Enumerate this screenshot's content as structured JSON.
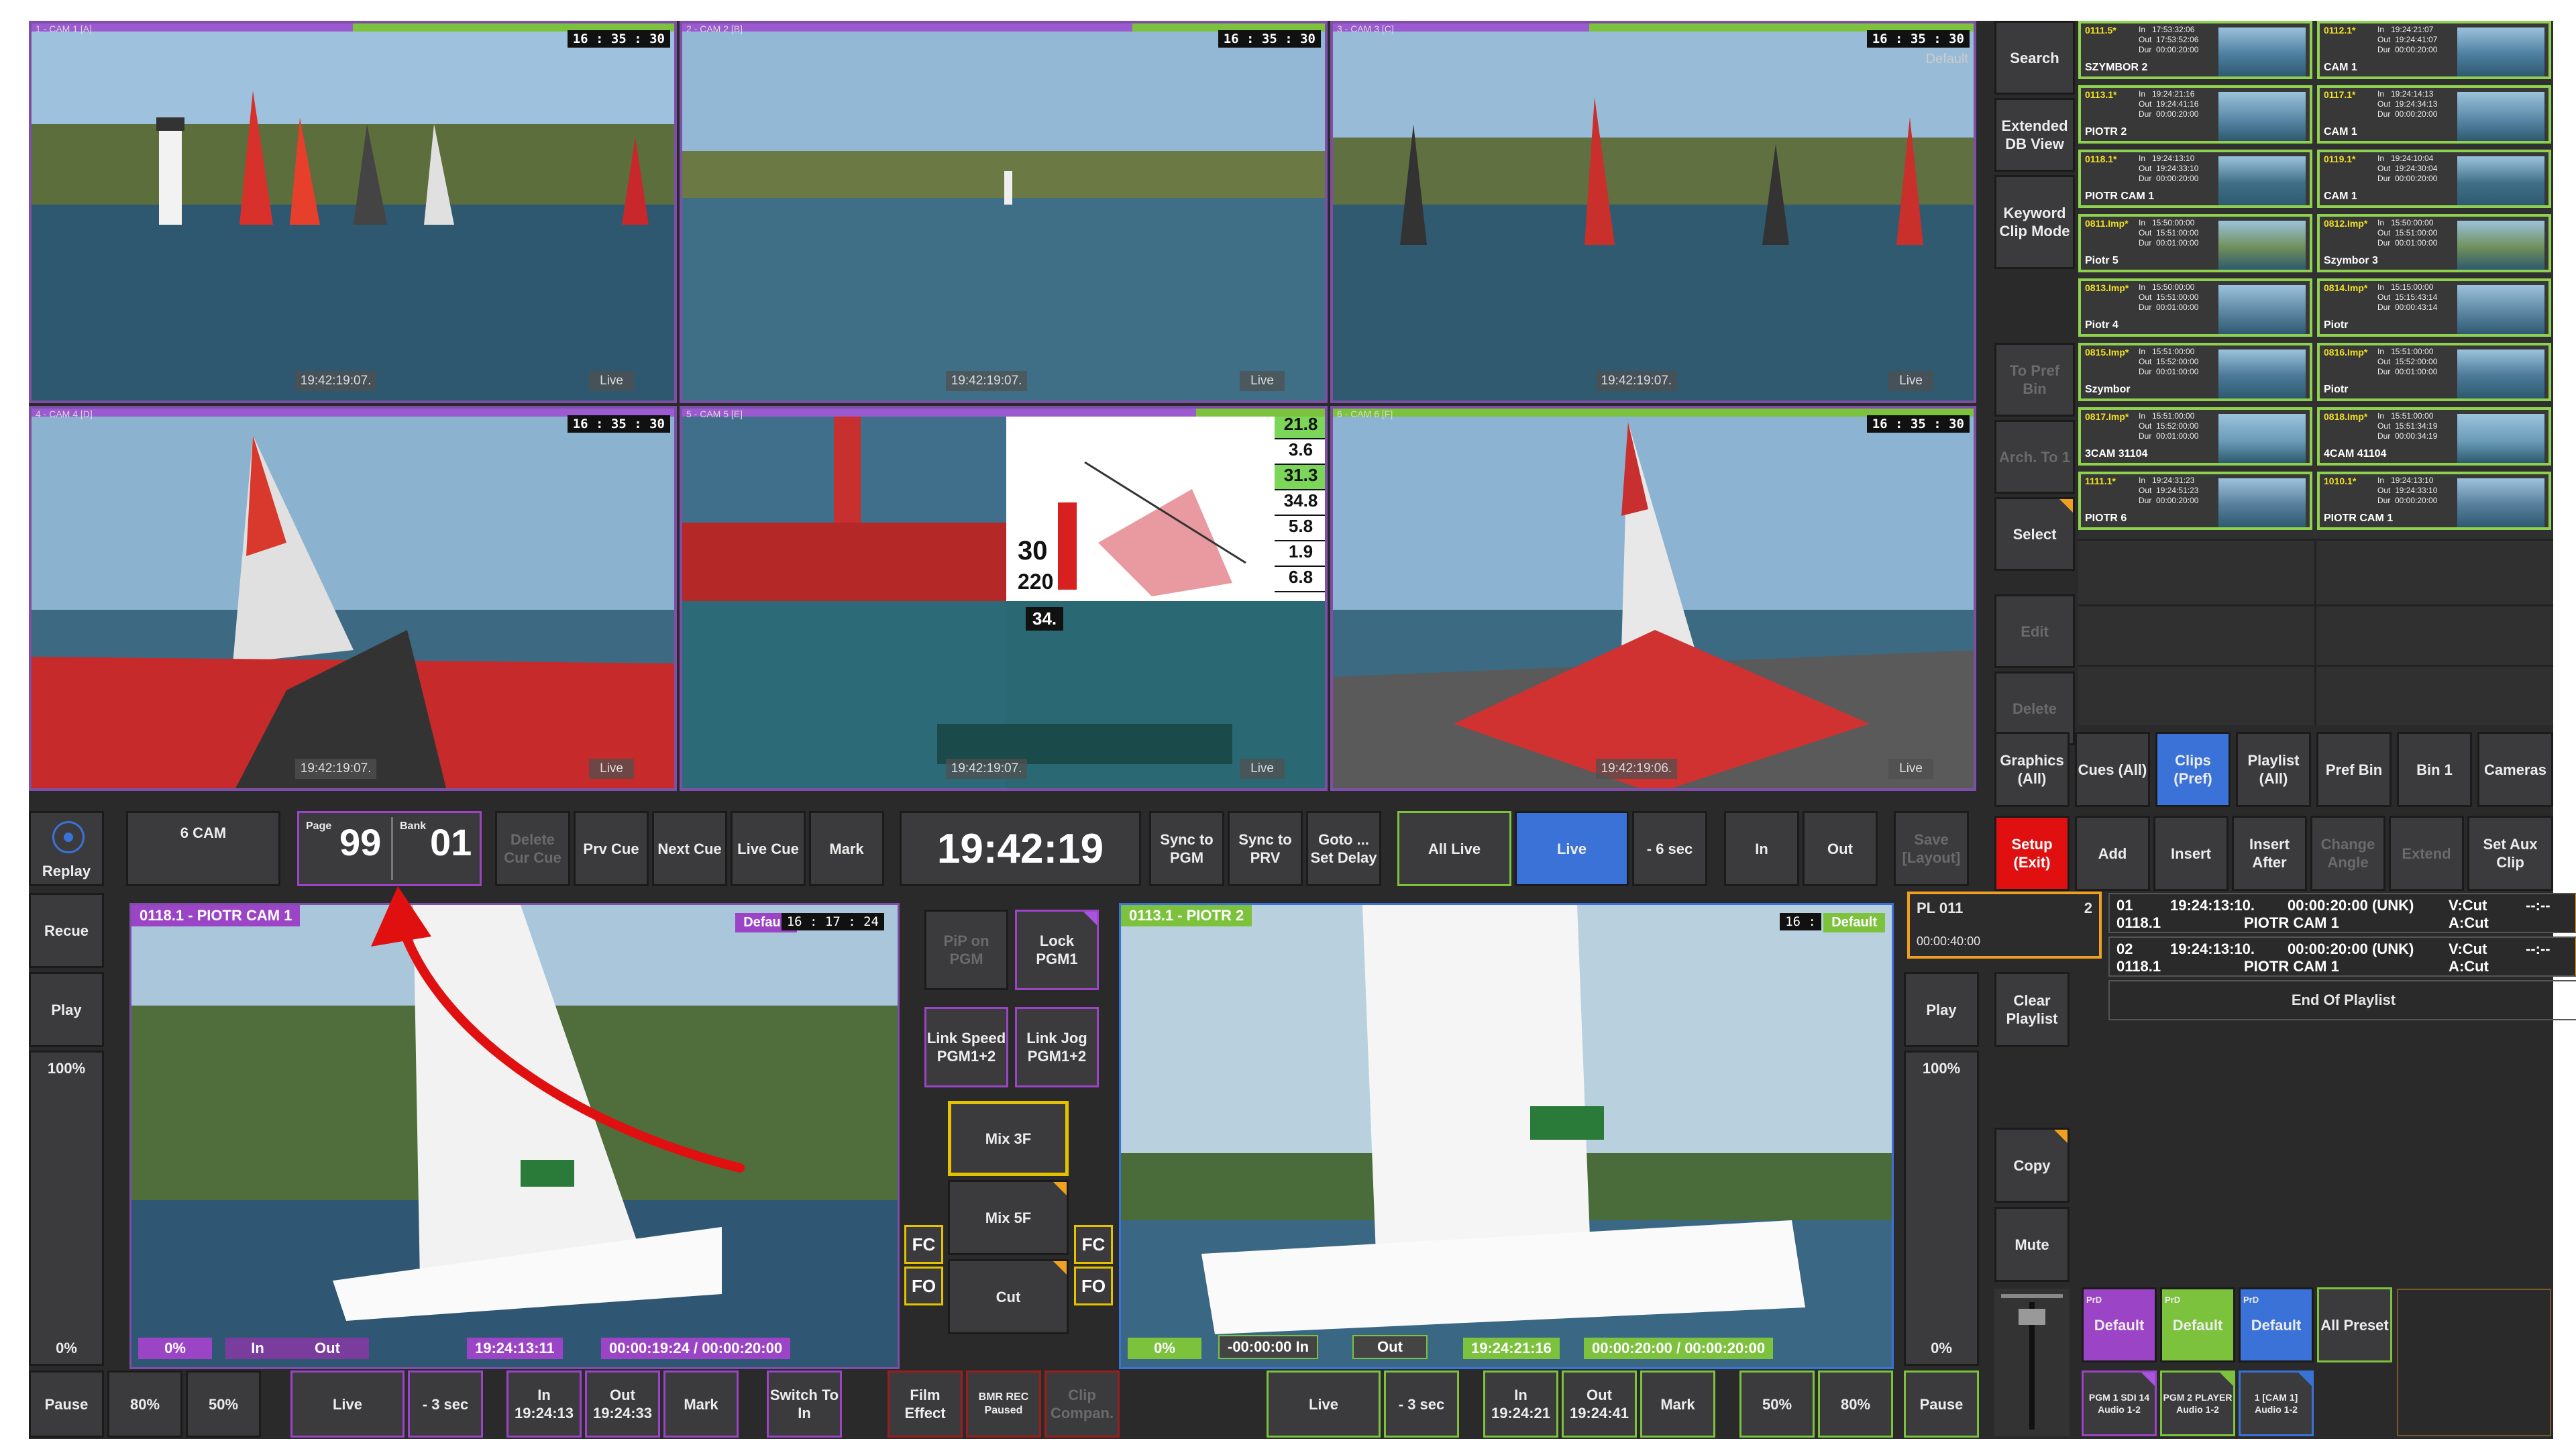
{
  "cameras": [
    {
      "label": "1 - CAM 1 [A]",
      "clock": "16 : 35 : 30",
      "tc": "19:42:19:07.",
      "status": "Live"
    },
    {
      "label": "2 - CAM 2 [B]",
      "clock": "16 : 35 : 30",
      "tc": "19:42:19:07.",
      "status": "Live"
    },
    {
      "label": "3 - CAM 3 [C]",
      "clock": "16 : 35 : 30",
      "tc": "19:42:19:07.",
      "status": "Live",
      "badge": "Default"
    },
    {
      "label": "4 - CAM 4 [D]",
      "clock": "16 : 35 : 30",
      "tc": "19:42:19:07.",
      "status": "Live"
    },
    {
      "label": "5 - CAM 5 [E]",
      "clock": "",
      "tc": "19:42:19:07.",
      "status": "Live"
    },
    {
      "label": "6 - CAM 6 [F]",
      "clock": "16 : 35 : 30",
      "tc": "19:42:19:06.",
      "status": "Live"
    }
  ],
  "overlay": {
    "speeds": [
      "21.8",
      "3.6",
      "31.3",
      "34.8",
      "5.8",
      "1.9",
      "6.8"
    ],
    "big1": "30",
    "big2": "220",
    "badge": "34."
  },
  "side_menu": [
    "Search",
    "Extended DB View",
    "Keyword Clip Mode",
    "To Pref Bin",
    "Arch. To 1",
    "Select",
    "Edit",
    "Delete"
  ],
  "clips_left": [
    {
      "name": "0111.5*",
      "meta": "In   17:53:32:06\nOut  17:53:52:06\nDur  00:00:20:00",
      "owner": "SZYMBOR 2"
    },
    {
      "name": "0113.1*",
      "meta": "In   19:24:21:16\nOut  19:24:41:16\nDur  00:00:20:00",
      "owner": "PIOTR 2"
    },
    {
      "name": "0118.1*",
      "meta": "In   19:24:13:10\nOut  19:24:33:10\nDur  00:00:20:00",
      "owner": "PIOTR CAM 1"
    },
    {
      "name": "0811.Imp*",
      "meta": "In   15:50:00:00\nOut  15:51:00:00\nDur  00:01:00:00",
      "owner": "Piotr 5"
    },
    {
      "name": "0813.Imp*",
      "meta": "In   15:50:00:00\nOut  15:51:00:00\nDur  00:01:00:00",
      "owner": "Piotr 4"
    },
    {
      "name": "0815.Imp*",
      "meta": "In   15:51:00:00\nOut  15:52:00:00\nDur  00:01:00:00",
      "owner": "Szymbor"
    },
    {
      "name": "0817.Imp*",
      "meta": "In   15:51:00:00\nOut  15:52:00:00\nDur  00:01:00:00",
      "owner": "3CAM 31104"
    },
    {
      "name": "1111.1*",
      "meta": "In   19:24:31:23\nOut  19:24:51:23\nDur  00:00:20:00",
      "owner": "PIOTR 6"
    }
  ],
  "clips_right": [
    {
      "name": "0112.1*",
      "meta": "In   19:24:21:07\nOut  19:24:41:07\nDur  00:00:20:00",
      "owner": "CAM 1"
    },
    {
      "name": "0117.1*",
      "meta": "In   19:24:14:13\nOut  19:24:34:13\nDur  00:00:20:00",
      "owner": "CAM 1"
    },
    {
      "name": "0119.1*",
      "meta": "In   19:24:10:04\nOut  19:24:30:04\nDur  00:00:20:00",
      "owner": "CAM 1"
    },
    {
      "name": "0812.Imp*",
      "meta": "In   15:50:00:00\nOut  15:51:00:00\nDur  00:01:00:00",
      "owner": "Szymbor 3"
    },
    {
      "name": "0814.Imp*",
      "meta": "In   15:15:00:00\nOut  15:15:43:14\nDur  00:00:43:14",
      "owner": "Piotr"
    },
    {
      "name": "0816.Imp*",
      "meta": "In   15:51:00:00\nOut  15:52:00:00\nDur  00:01:00:00",
      "owner": "Piotr"
    },
    {
      "name": "0818.Imp*",
      "meta": "In   15:51:00:00\nOut  15:51:34:19\nDur  00:00:34:19",
      "owner": "4CAM 41104"
    },
    {
      "name": "1010.1*",
      "meta": "In   19:24:13:10\nOut  19:24:33:10\nDur  00:00:20:00",
      "owner": "PIOTR CAM 1"
    }
  ],
  "tabs": [
    "Graphics (All)",
    "Cues (All)",
    "Clips (Pref)",
    "Playlist (All)",
    "Pref Bin",
    "Bin 1",
    "Cameras"
  ],
  "row_mid": {
    "replay": "Replay",
    "layout": "6 CAM",
    "page_label": "Page",
    "page": "99",
    "bank_label": "Bank",
    "bank": "01",
    "delete_cue": "Delete Cur Cue",
    "prv_cue": "Prv Cue",
    "next_cue": "Next Cue",
    "live_cue": "Live Cue",
    "mark": "Mark",
    "clock": "19:42:19",
    "sync_pgm": "Sync to PGM",
    "sync_prv": "Sync to PRV",
    "goto": "Goto ... Set Delay",
    "all_live": "All Live",
    "live": "Live",
    "minus6": "- 6 sec",
    "in": "In",
    "out": "Out",
    "save_layout": "Save [Layout]"
  },
  "actions": {
    "setup": "Setup (Exit)",
    "add": "Add",
    "insert": "Insert",
    "insert_after": "Insert After",
    "change_angle": "Change Angle",
    "extend": "Extend",
    "set_aux": "Set Aux Clip"
  },
  "left_side": {
    "recue": "Recue",
    "play": "Play",
    "speed": "100%",
    "zero": "0%"
  },
  "pgm1": {
    "title": "0118.1 - PIOTR CAM 1",
    "badge": "Default",
    "clock": "16 : 17 : 24",
    "pct": "0%",
    "in": "In",
    "out": "Out",
    "tc": "19:24:13:11",
    "dur": "00:00:19:24 / 00:00:20:00"
  },
  "pgm2": {
    "title": "0113.1 - PIOTR 2",
    "badge": "Default",
    "clock": "16 : ",
    "pct": "0%",
    "in": "-00:00:00 In",
    "out": "Out",
    "tc": "19:24:21:16",
    "dur": "00:00:20:00 / 00:00:20:00"
  },
  "center": {
    "pip": "PiP on PGM",
    "lock": "Lock PGM1",
    "link_speed": "Link Speed PGM1+2",
    "link_jog": "Link Jog PGM1+2",
    "mix3": "Mix 3F",
    "mix5": "Mix 5F",
    "cut": "Cut",
    "fc": "FC",
    "fo": "FO"
  },
  "right_side": {
    "play": "Play",
    "speed": "100%",
    "zero": "0%",
    "clear": "Clear Playlist",
    "copy": "Copy",
    "mute": "Mute"
  },
  "playlist": {
    "name": "PL 011",
    "count": "2",
    "dur": "00:00:40:00",
    "rows": [
      {
        "num": "01",
        "clip": "0118.1",
        "tc": "19:24:13:10.",
        "dur": "00:00:20:00 (UNK)",
        "cam": "PIOTR CAM 1",
        "v": "V:Cut",
        "a": "A:Cut",
        "tail": "--:--"
      },
      {
        "num": "02",
        "clip": "0118.1",
        "tc": "19:24:13:10.",
        "dur": "00:00:20:00 (UNK)",
        "cam": "PIOTR CAM 1",
        "v": "V:Cut",
        "a": "A:Cut",
        "tail": "--:--"
      }
    ],
    "end": "End Of Playlist"
  },
  "presets": {
    "prd": "PrD",
    "default": "Default",
    "all": "All Preset",
    "outs": [
      "PGM 1 SDI 14 Audio 1-2",
      "PGM 2 PLAYER Audio 1-2",
      "1 [CAM 1] Audio 1-2"
    ]
  },
  "bottom": {
    "pause": "Pause",
    "p80": "80%",
    "p50": "50%",
    "live": "Live",
    "minus3": "- 3 sec",
    "in1": "In 19:24:13",
    "out1": "Out 19:24:33",
    "mark": "Mark",
    "switch": "Switch To In",
    "film": "Film Effect",
    "bmr": "BMR REC Paused",
    "clip_comp": "Clip Compan.",
    "live2": "Live",
    "minus3b": "- 3 sec",
    "in2": "In 19:24:21",
    "out2": "Out 19:24:41",
    "mark2": "Mark",
    "p50b": "50%",
    "p80b": "80%",
    "pause2": "Pause"
  },
  "colors": {
    "purple": "#9c44c6",
    "green": "#7cc23d",
    "blue": "#3a72d8",
    "yellow": "#e5c200",
    "red": "#e01010",
    "orange": "#f0a020"
  }
}
